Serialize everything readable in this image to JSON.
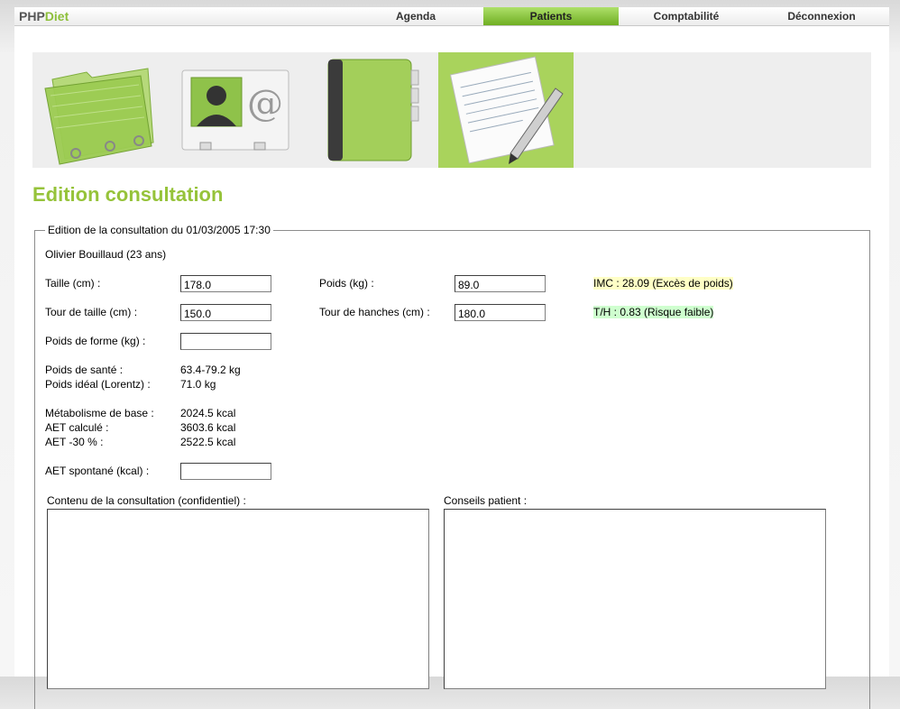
{
  "app": {
    "logo_part1": "PHP",
    "logo_part2": "Diet"
  },
  "nav": [
    {
      "label": "Agenda"
    },
    {
      "label": "Patients"
    },
    {
      "label": "Comptabilité"
    },
    {
      "label": "Déconnexion"
    }
  ],
  "banner_icons": [
    "folder-icon",
    "contact-card-icon",
    "address-book-icon",
    "document-edit-icon"
  ],
  "page": {
    "title": "Edition consultation"
  },
  "form": {
    "legend": "Edition de la consultation du 01/03/2005 17:30",
    "patient": "Olivier Bouillaud (23 ans)",
    "taille_label": "Taille (cm) :",
    "taille_value": "178.0",
    "poids_label": "Poids (kg) :",
    "poids_value": "89.0",
    "imc": "IMC : 28.09 (Excès de poids)",
    "tour_taille_label": "Tour de taille (cm) :",
    "tour_taille_value": "150.0",
    "tour_hanches_label": "Tour de hanches (cm) :",
    "tour_hanches_value": "180.0",
    "th": "T/H : 0.83 (Risque faible)",
    "poids_forme_label": "Poids de forme (kg) :",
    "poids_forme_value": "",
    "poids_sante_label": "Poids de santé :",
    "poids_sante_value": "63.4-79.2 kg",
    "poids_ideal_label": "Poids idéal (Lorentz) :",
    "poids_ideal_value": "71.0 kg",
    "metab_label": "Métabolisme de base :",
    "metab_value": "2024.5 kcal",
    "aet_calc_label": "AET calculé :",
    "aet_calc_value": "3603.6 kcal",
    "aet30_label": "AET -30 % :",
    "aet30_value": "2522.5 kcal",
    "aet_spont_label": "AET spontané (kcal) :",
    "aet_spont_value": "",
    "contenu_label": "Contenu de la consultation (confidentiel) :",
    "conseils_label": "Conseils patient :"
  },
  "colors": {
    "accent": "#96c33a",
    "nav_active": "#8dcf3f"
  }
}
